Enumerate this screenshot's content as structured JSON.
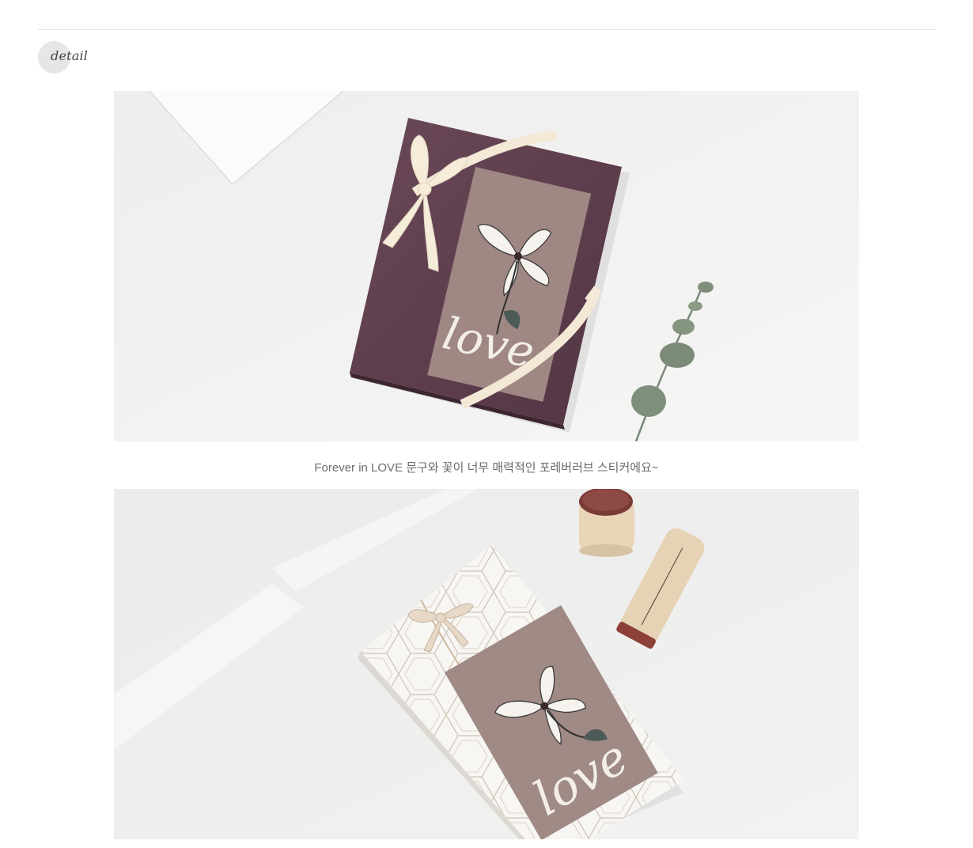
{
  "section": {
    "label": "detail"
  },
  "photos": [
    {
      "subject": "purple-gift-box-with-ribbon-and-love-sticker"
    },
    {
      "subject": "geometric-wrapped-gift-with-love-sticker-and-stamps"
    }
  ],
  "sticker_text": "love",
  "caption": "Forever in LOVE 문구와 꽃이 너무 매력적인 포레버러브 스티커에요~",
  "colors": {
    "background": "#ffffff",
    "divider": "#e3e3e3",
    "badge": "#e6e6e6",
    "caption_text": "#6b6b6b",
    "box_purple": "#5a3a48",
    "sticker_mauve": "#9e8682",
    "ribbon_cream": "#f4ead8",
    "leaf_green": "#7d8f7c"
  }
}
